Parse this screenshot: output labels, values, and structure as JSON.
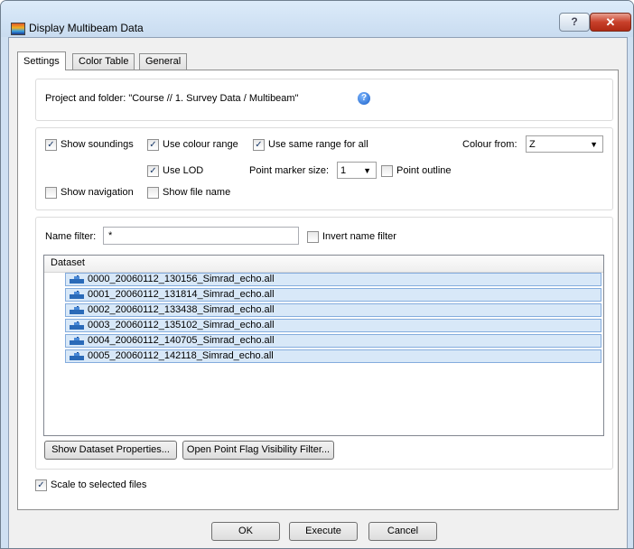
{
  "window": {
    "title": "Display Multibeam Data",
    "help_glyph": "?",
    "close_glyph": "✕"
  },
  "tabs": [
    {
      "label": "Settings",
      "active": true
    },
    {
      "label": "Color Table",
      "active": false
    },
    {
      "label": "General",
      "active": false
    }
  ],
  "project": {
    "text": "Project and folder: \"Course // 1. Survey Data / Multibeam\"",
    "help_icon": "help-question-icon"
  },
  "options": {
    "show_soundings": {
      "label": "Show soundings",
      "checked": true
    },
    "use_colour_range": {
      "label": "Use colour range",
      "checked": true
    },
    "use_same_range": {
      "label": "Use same range for all",
      "checked": true
    },
    "colour_from_label": "Colour from:",
    "colour_from_value": "Z",
    "use_lod": {
      "label": "Use LOD",
      "checked": true
    },
    "point_marker_label": "Point marker size:",
    "point_marker_value": "1",
    "point_outline": {
      "label": "Point outline",
      "checked": false
    },
    "show_navigation": {
      "label": "Show navigation",
      "checked": false
    },
    "show_file_name": {
      "label": "Show file name",
      "checked": false
    }
  },
  "filter": {
    "label": "Name filter:",
    "value": "*",
    "invert": {
      "label": "Invert name filter",
      "checked": false
    }
  },
  "dataset": {
    "header": "Dataset",
    "files": [
      "0000_20060112_130156_Simrad_echo.all",
      "0001_20060112_131814_Simrad_echo.all",
      "0002_20060112_133438_Simrad_echo.all",
      "0003_20060112_135102_Simrad_echo.all",
      "0004_20060112_140705_Simrad_echo.all",
      "0005_20060112_142118_Simrad_echo.all"
    ]
  },
  "buttons": {
    "show_props": "Show Dataset Properties...",
    "open_filter": "Open Point Flag Visibility Filter...",
    "ok": "OK",
    "execute": "Execute",
    "cancel": "Cancel"
  },
  "scale": {
    "label": "Scale to selected files",
    "checked": true
  },
  "checkmark": "✓",
  "dropdown_arrow": "▼"
}
